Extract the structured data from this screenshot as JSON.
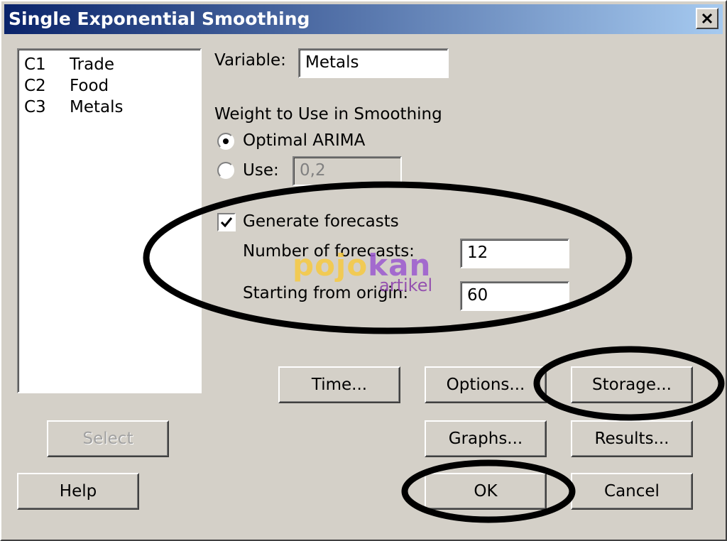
{
  "window": {
    "title": "Single Exponential Smoothing",
    "titlebar_colors": [
      "#0a246a",
      "#a6caf0"
    ]
  },
  "variables_list": [
    {
      "id": "C1",
      "name": "Trade"
    },
    {
      "id": "C2",
      "name": "Food"
    },
    {
      "id": "C3",
      "name": "Metals"
    }
  ],
  "variable": {
    "label": "Variable:",
    "value": "Metals"
  },
  "weight": {
    "heading": "Weight to Use in Smoothing",
    "optimal_label": "Optimal ARIMA",
    "use_label": "Use:",
    "use_value": "0,2",
    "selected": "Optimal ARIMA"
  },
  "forecast": {
    "generate_label": "Generate forecasts",
    "generate_checked": true,
    "number_label": "Number of forecasts:",
    "number_value": "12",
    "origin_label": "Starting from origin:",
    "origin_value": "60"
  },
  "buttons": {
    "time": "Time...",
    "options": "Options...",
    "storage": "Storage...",
    "select": "Select",
    "graphs": "Graphs...",
    "results": "Results...",
    "help": "Help",
    "ok": "OK",
    "cancel": "Cancel"
  },
  "watermark": {
    "main_a": "pojo",
    "main_b": "kan",
    "sub": "artikel"
  },
  "icons": {
    "close": "close-icon",
    "check": "checkmark-icon"
  }
}
